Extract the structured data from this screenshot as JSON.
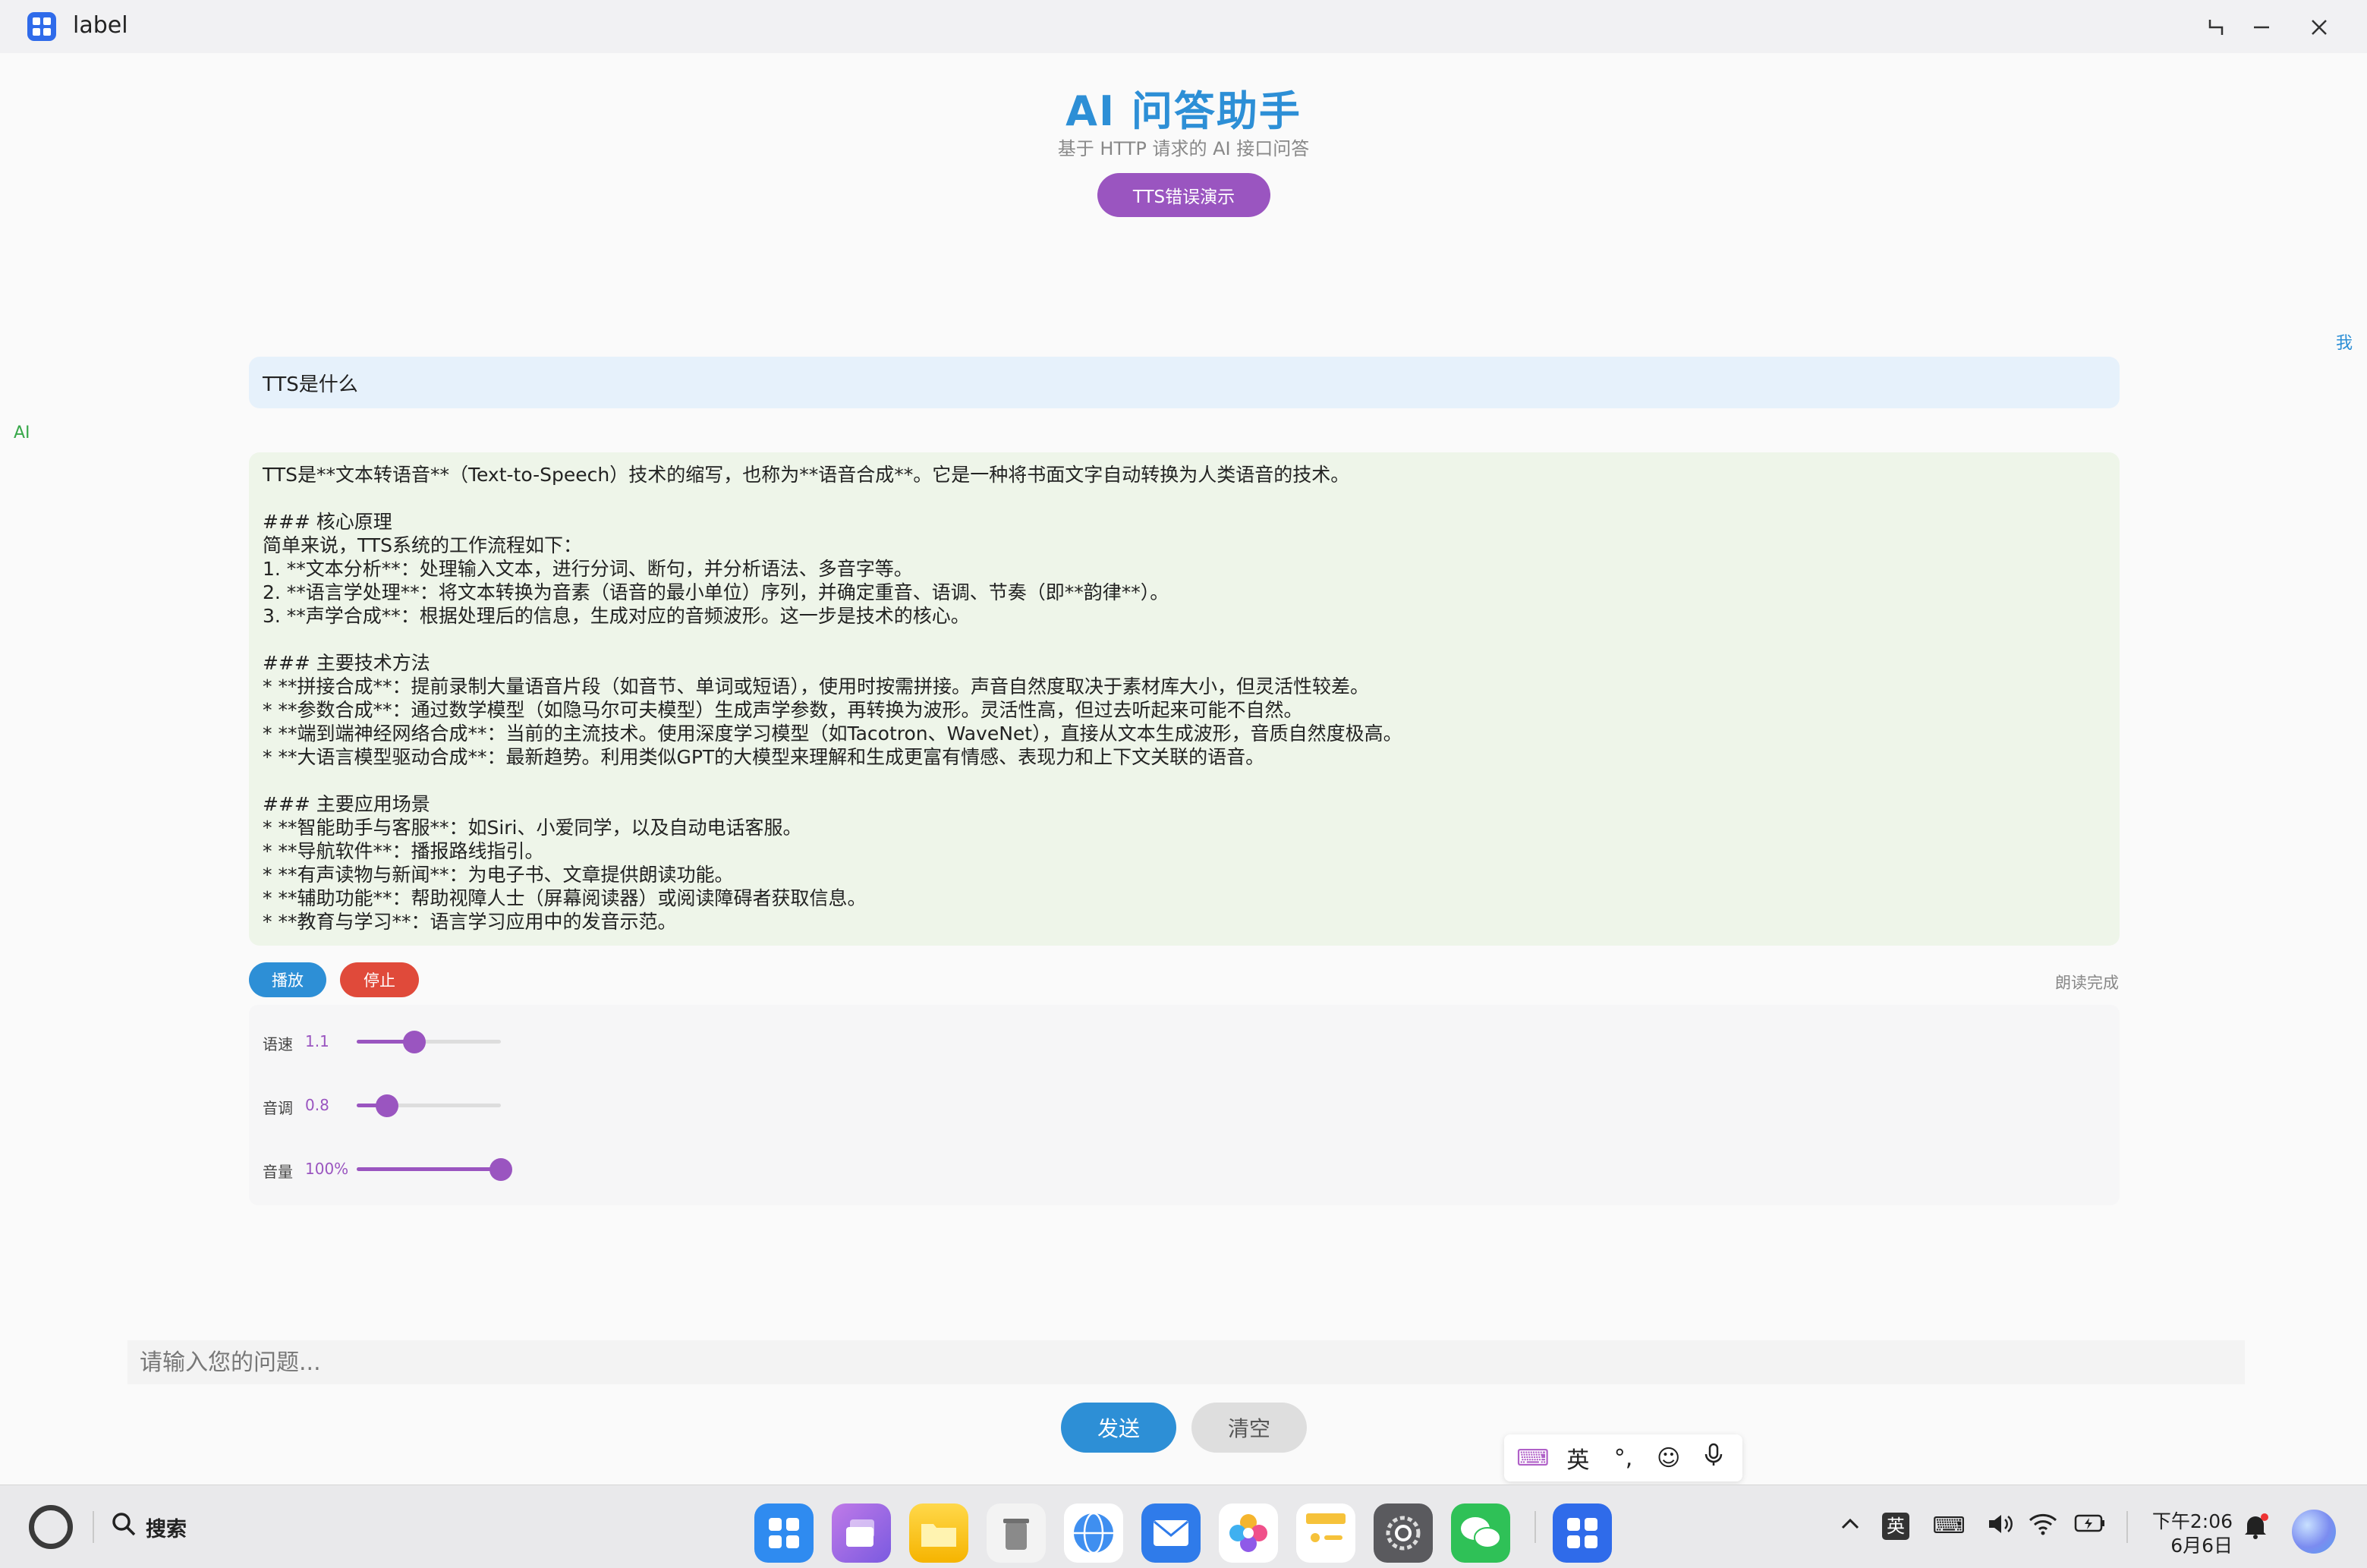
{
  "window": {
    "title": "label",
    "controls": [
      "restore-icon",
      "minimize-icon",
      "close-icon"
    ]
  },
  "header": {
    "title": "AI 问答助手",
    "subtitle": "基于 HTTP 请求的 AI 接口问答",
    "demo_button": "TTS错误演示"
  },
  "chat": {
    "me_label": "我",
    "ai_label": "AI",
    "user_message": "TTS是什么",
    "ai_message_lines": [
      "TTS是**文本转语音**（Text-to-Speech）技术的缩写，也称为**语音合成**。它是一种将书面文字自动转换为人类语音的技术。",
      "",
      "### 核心原理",
      "简单来说，TTS系统的工作流程如下：",
      "1. **文本分析**：处理输入文本，进行分词、断句，并分析语法、多音字等。",
      "2. **语言学处理**：将文本转换为音素（语音的最小单位）序列，并确定重音、语调、节奏（即**韵律**）。",
      "3. **声学合成**：根据处理后的信息，生成对应的音频波形。这一步是技术的核心。",
      "",
      "### 主要技术方法",
      "* **拼接合成**：提前录制大量语音片段（如音节、单词或短语），使用时按需拼接。声音自然度取决于素材库大小，但灵活性较差。",
      "* **参数合成**：通过数学模型（如隐马尔可夫模型）生成声学参数，再转换为波形。灵活性高，但过去听起来可能不自然。",
      "* **端到端神经网络合成**：当前的主流技术。使用深度学习模型（如Tacotron、WaveNet），直接从文本生成波形，音质自然度极高。",
      "* **大语言模型驱动合成**：最新趋势。利用类似GPT的大模型来理解和生成更富有情感、表现力和上下文关联的语音。",
      "",
      "### 主要应用场景",
      "* **智能助手与客服**：如Siri、小爱同学，以及自动电话客服。",
      "* **导航软件**：播报路线指引。",
      "* **有声读物与新闻**：为电子书、文章提供朗读功能。",
      "* **辅助功能**：帮助视障人士（屏幕阅读器）或阅读障碍者获取信息。",
      "* **教育与学习**：语言学习应用中的发音示范。"
    ]
  },
  "playback": {
    "play_label": "播放",
    "stop_label": "停止",
    "status": "朗读完成"
  },
  "sliders": {
    "rate": {
      "label": "语速",
      "value": "1.1",
      "fraction": 0.4
    },
    "pitch": {
      "label": "音调",
      "value": "0.8",
      "fraction": 0.21
    },
    "volume": {
      "label": "音量",
      "value": "100%",
      "fraction": 1.0
    }
  },
  "input": {
    "placeholder": "请输入您的问题...",
    "value": "",
    "send_label": "发送",
    "clear_label": "清空"
  },
  "ime": {
    "items": [
      "keyboard-icon",
      "英",
      "punctuation-icon",
      "emoji-icon",
      "microphone-icon"
    ],
    "mode_label": "英"
  },
  "taskbar": {
    "search_label": "搜索",
    "dock": [
      "launcher-icon",
      "multitask-icon",
      "files-icon",
      "trash-icon",
      "browser-icon",
      "mail-icon",
      "photos-icon",
      "notes-icon",
      "settings-icon",
      "wechat-icon",
      "label-app-icon"
    ],
    "tray_ime": "英",
    "time": "下午2:06",
    "date": "6月6日"
  },
  "colors": {
    "accent_blue": "#2d8fd6",
    "accent_purple": "#9a55c0",
    "stop_red": "#e04a3a",
    "user_bubble": "#e6f1fb",
    "ai_bubble": "#eef5e9",
    "ai_label_green": "#38a84a"
  }
}
